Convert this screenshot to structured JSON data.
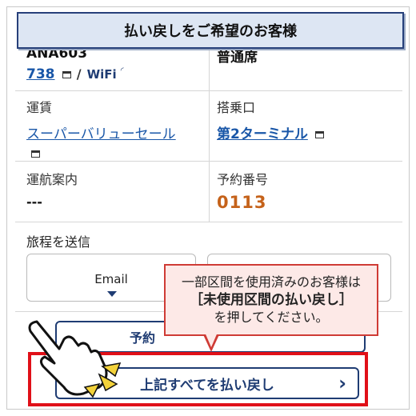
{
  "header": {
    "title": "払い戻しをご希望のお客様"
  },
  "flight": {
    "number": "ANA603",
    "aircraft": "738",
    "separator": "/",
    "wifi": "WiFi",
    "seat_class": "普通席"
  },
  "fare": {
    "label": "運賃",
    "value": "スーパーバリューセール"
  },
  "boarding": {
    "label": "搭乗口",
    "value": "第2ターミナル"
  },
  "operation": {
    "label": "運航案内",
    "value": "---"
  },
  "reservation": {
    "label": "予約番号",
    "value": "0113"
  },
  "itinerary": {
    "label": "旅程を送信",
    "email_label": "Email"
  },
  "buttons": {
    "reservation_partial": "予約",
    "refund_all": "上記すべてを払い戻し",
    "refund_arrow": "›"
  },
  "callout": {
    "line1": "一部区間を使用済みのお客様は",
    "line2": "［未使用区間の払い戻し］",
    "line3": "を押してください。"
  },
  "colors": {
    "accent": "#1a57a8",
    "orange": "#c5621a",
    "highlight": "#e01018",
    "callout_bg": "#fde9e7"
  }
}
